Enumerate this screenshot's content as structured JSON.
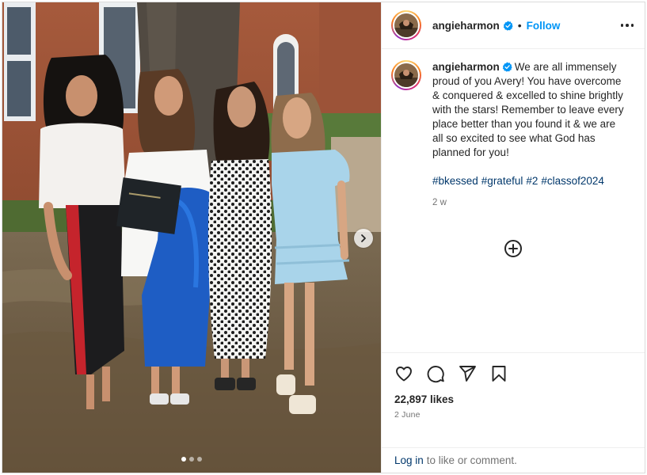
{
  "post": {
    "username": "angieharmon",
    "verified": true,
    "separator": "•",
    "follow_label": "Follow",
    "more_icon": "more-options-icon"
  },
  "caption": {
    "username": "angieharmon",
    "text": "We are all immensely proud of you Avery! You have overcome & conquered & excelled to shine brightly with the stars! Remember to leave every place better than you found it & we are all so excited to see what God has planned for you!",
    "hashtags": [
      "#bkessed",
      "#grateful",
      "#2",
      "#classof2024"
    ],
    "age": "2 w"
  },
  "media": {
    "carousel_total": 3,
    "carousel_active": 1
  },
  "actions": {
    "icons": [
      "heart-icon",
      "comment-icon",
      "share-icon",
      "bookmark-icon"
    ],
    "likes": "22,897 likes",
    "date": "2 June"
  },
  "footer": {
    "login_link": "Log in",
    "login_rest": "to like or comment."
  },
  "colors": {
    "link_blue": "#0095f6",
    "hashtag": "#00376b",
    "muted": "#737373",
    "border": "#dbdbdb"
  }
}
